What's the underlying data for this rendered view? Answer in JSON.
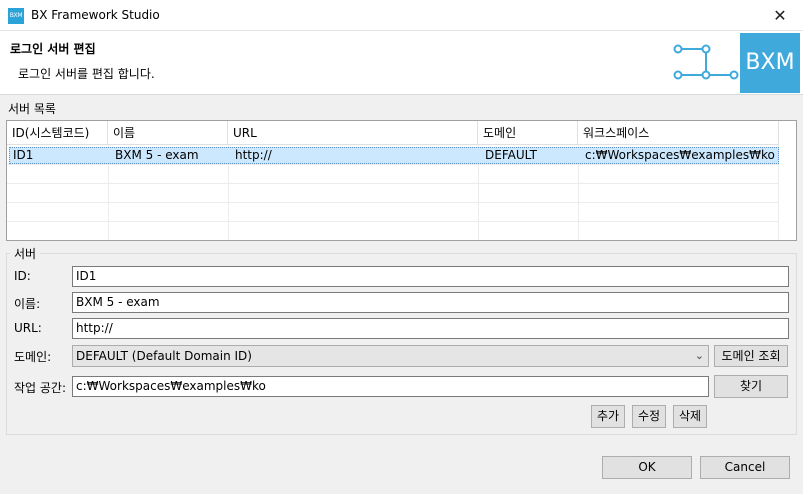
{
  "window": {
    "icon_label": "BXM",
    "title": "BX Framework Studio",
    "close_glyph": "✕"
  },
  "header": {
    "title": "로그인 서버 편집",
    "description": "로그인 서버를 편집 합니다.",
    "logo_text": "BXM"
  },
  "server_list": {
    "label": "서버 목록",
    "columns": [
      "ID(시스템코드)",
      "이름",
      "URL",
      "도메인",
      "워크스페이스"
    ],
    "rows": [
      [
        "ID1",
        "BXM 5 - exam",
        "http://",
        "DEFAULT",
        "c:₩Workspaces₩examples₩ko"
      ]
    ]
  },
  "server_form": {
    "group_label": "서버",
    "id_label": "ID:",
    "id_value": "ID1",
    "name_label": "이름:",
    "name_value": "BXM 5 - exam",
    "url_label": "URL:",
    "url_value": "http://",
    "domain_label": "도메인:",
    "domain_value": "DEFAULT (Default Domain ID)",
    "domain_lookup_button": "도메인 조회",
    "workspace_label": "작업 공간:",
    "workspace_value": "c:₩Workspaces₩examples₩ko",
    "browse_button": "찾기",
    "add_button": "추가",
    "edit_button": "수정",
    "delete_button": "삭제"
  },
  "footer": {
    "ok_button": "OK",
    "cancel_button": "Cancel"
  },
  "colors": {
    "accent": "#3fa9dc",
    "selection": "#cce8ff"
  },
  "icons": [
    "app-icon",
    "close-icon",
    "connector-deco-icon",
    "dropdown-arrow-icon"
  ]
}
